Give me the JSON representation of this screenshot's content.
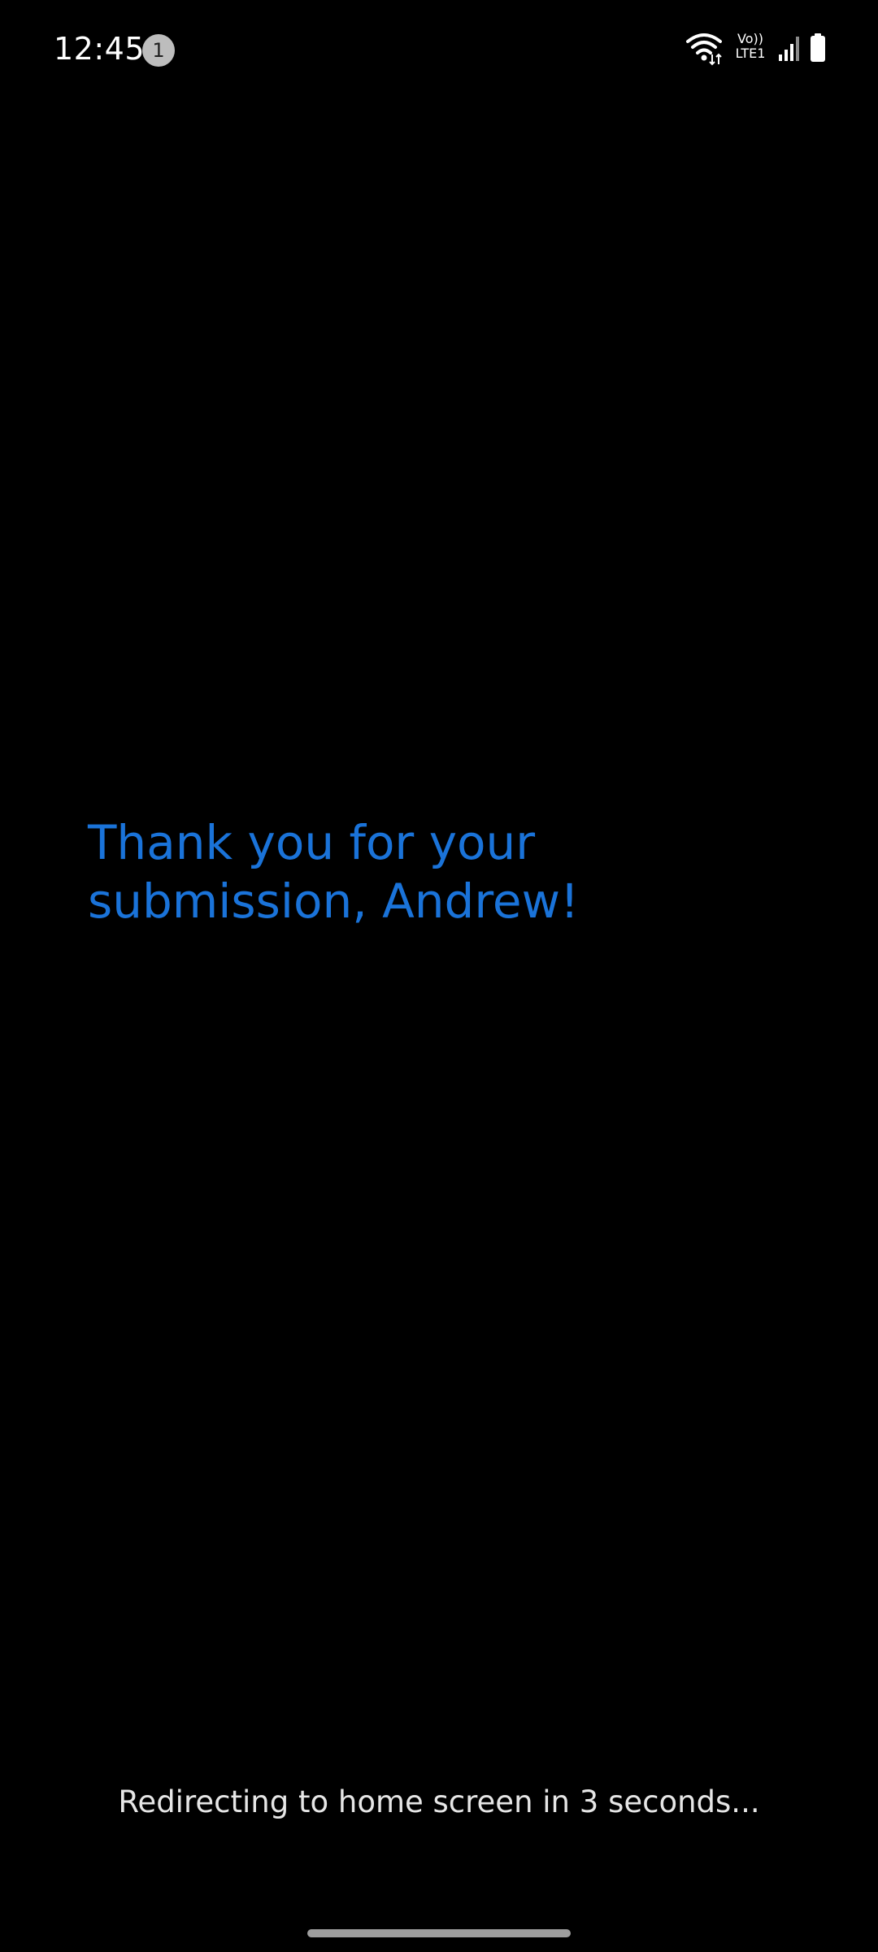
{
  "status_bar": {
    "time": "12:45",
    "notification_count": "1",
    "volte_top": "Vo))",
    "volte_bottom": "LTE1",
    "icons": [
      "wifi-icon",
      "volte-lte-icon",
      "signal-icon",
      "battery-icon"
    ]
  },
  "main": {
    "message": "Thank you for your submission, Andrew!",
    "message_color": "#1a73d9"
  },
  "footer": {
    "redirect_text": "Redirecting to home screen in 3 seconds..."
  }
}
